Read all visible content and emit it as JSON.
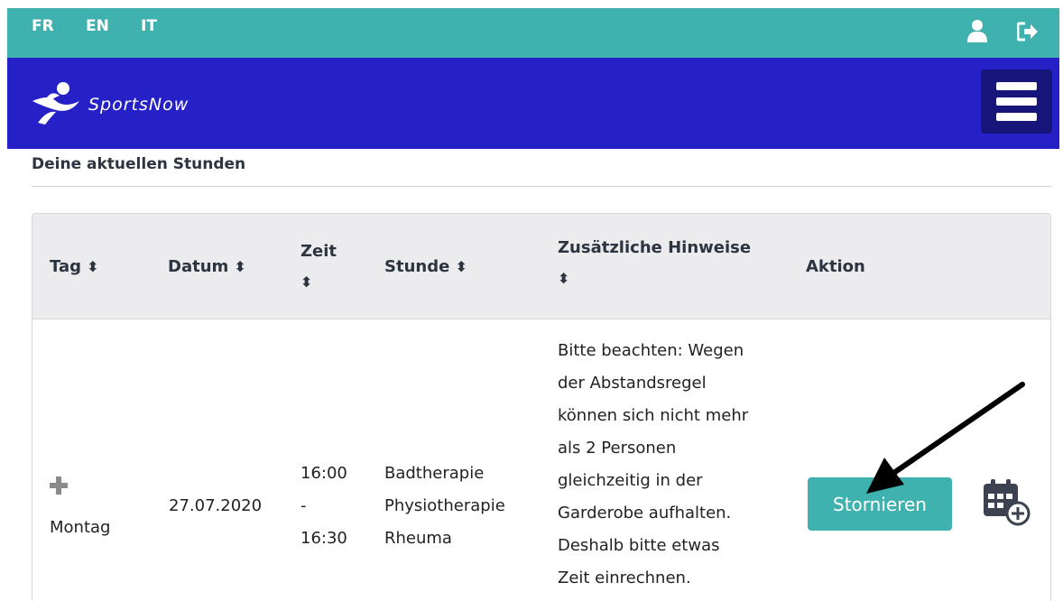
{
  "colors": {
    "teal": "#3fb2b0",
    "navy": "#2620c7",
    "arrow": "#000000"
  },
  "topbar": {
    "languages": [
      "FR",
      "EN",
      "IT"
    ],
    "icons": [
      "user-icon",
      "logout-icon"
    ]
  },
  "navbar": {
    "logo_text": "SportsNow",
    "menu_icon": "hamburger-icon"
  },
  "section": {
    "title": "Deine aktuellen Stunden"
  },
  "table": {
    "headers": {
      "tag": "Tag",
      "datum": "Datum",
      "zeit": "Zeit",
      "stunde": "Stunde",
      "hinweise": "Zusätzliche Hinweise",
      "aktion": "Aktion"
    },
    "sort_glyph": "⬍",
    "rows": [
      {
        "tag": "Montag",
        "datum": "27.07.2020",
        "zeit_start": "16:00",
        "zeit_sep": "-",
        "zeit_end": "16:30",
        "stunde": [
          "Badtherapie",
          "Physiotherapie",
          "Rheuma"
        ],
        "hinweise": [
          "Bitte beachten: Wegen",
          "der Abstandsregel",
          "können sich nicht mehr",
          "als 2 Personen",
          "gleichzeitig in der",
          "Garderobe aufhalten.",
          "Deshalb bitte etwas",
          "Zeit einrechnen."
        ],
        "action_label": "Stornieren",
        "calendar_icon": "calendar-add-icon"
      }
    ]
  }
}
